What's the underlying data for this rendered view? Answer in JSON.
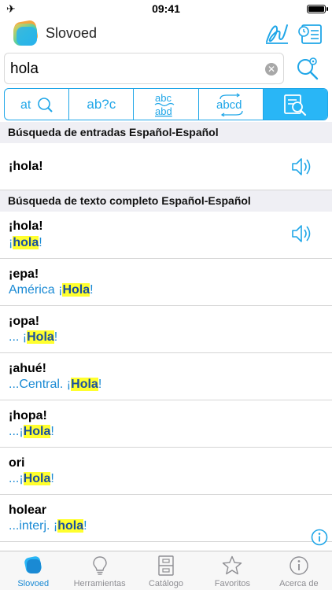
{
  "status_bar": {
    "time": "09:41"
  },
  "header": {
    "app_name": "Slovoed"
  },
  "search": {
    "value": "hola",
    "placeholder": ""
  },
  "modes": [
    {
      "label": "a→Q",
      "icon": "spelling-search-icon"
    },
    {
      "label": "ab?c",
      "icon": "wildcard-search-icon"
    },
    {
      "label": "abc/abd",
      "icon": "fuzzy-search-icon"
    },
    {
      "label": "abcd",
      "icon": "anagram-search-icon"
    },
    {
      "label": "",
      "icon": "full-text-search-icon",
      "active": true
    }
  ],
  "sections": [
    {
      "title": "Búsqueda de entradas Español-Español",
      "rows": [
        {
          "headword": "¡hola!"
        }
      ]
    },
    {
      "title": "Búsqueda de texto completo Español-Español",
      "rows": [
        {
          "headword": "¡hola!",
          "snippet_before": "¡",
          "highlight": "hola",
          "snippet_after": "!"
        },
        {
          "headword": "¡epa!",
          "snippet_before": "América ¡",
          "highlight": "Hola",
          "snippet_after": "!"
        },
        {
          "headword": "¡opa!",
          "snippet_before": "... ¡",
          "highlight": "Hola",
          "snippet_after": "!"
        },
        {
          "headword": "¡ahué!",
          "snippet_before": "...Central. ¡",
          "highlight": "Hola",
          "snippet_after": "!"
        },
        {
          "headword": "¡hopa!",
          "snippet_before": "...¡",
          "highlight": "Hola",
          "snippet_after": "!"
        },
        {
          "headword": "ori",
          "snippet_before": "...¡",
          "highlight": "Hola",
          "snippet_after": "!"
        },
        {
          "headword": "holear",
          "snippet_before": "...interj. ¡",
          "highlight": "hola",
          "snippet_after": "!"
        }
      ]
    }
  ],
  "tabs": [
    {
      "label": "Slovoed",
      "icon": "slovoed-logo-icon",
      "active": true
    },
    {
      "label": "Herramientas",
      "icon": "lightbulb-icon"
    },
    {
      "label": "Catálogo",
      "icon": "cabinet-icon"
    },
    {
      "label": "Favoritos",
      "icon": "star-icon"
    },
    {
      "label": "Acerca de",
      "icon": "info-icon"
    }
  ],
  "colors": {
    "accent": "#1fa6e8",
    "active_mode": "#29b6f6",
    "highlight": "#ffff2e",
    "link": "#1a8ad4"
  }
}
